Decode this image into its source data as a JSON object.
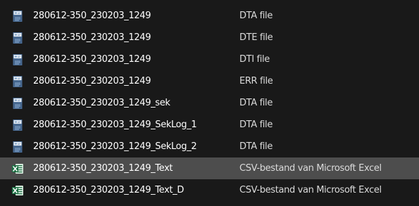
{
  "colors": {
    "background": "#191919",
    "selected_row": "#4d4d4d",
    "text": "#ffffff",
    "excel_green": "#1d7044"
  },
  "files": [
    {
      "name": "280612-350_230203_1249",
      "type": "DTA file",
      "icon": "generic-file-icon",
      "selected": false
    },
    {
      "name": "280612-350_230203_1249",
      "type": "DTE file",
      "icon": "generic-file-icon",
      "selected": false
    },
    {
      "name": "280612-350_230203_1249",
      "type": "DTI file",
      "icon": "generic-file-icon",
      "selected": false
    },
    {
      "name": "280612-350_230203_1249",
      "type": "ERR file",
      "icon": "generic-file-icon",
      "selected": false
    },
    {
      "name": "280612-350_230203_1249_sek",
      "type": "DTA file",
      "icon": "generic-file-icon",
      "selected": false
    },
    {
      "name": "280612-350_230203_1249_SekLog_1",
      "type": "DTA file",
      "icon": "generic-file-icon",
      "selected": false
    },
    {
      "name": "280612-350_230203_1249_SekLog_2",
      "type": "DTA file",
      "icon": "generic-file-icon",
      "selected": false
    },
    {
      "name": "280612-350_230203_1249_Text",
      "type": "CSV-bestand van Microsoft Excel",
      "icon": "excel-csv-icon",
      "selected": true
    },
    {
      "name": "280612-350_230203_1249_Text_D",
      "type": "CSV-bestand van Microsoft Excel",
      "icon": "excel-csv-icon",
      "selected": false
    }
  ]
}
